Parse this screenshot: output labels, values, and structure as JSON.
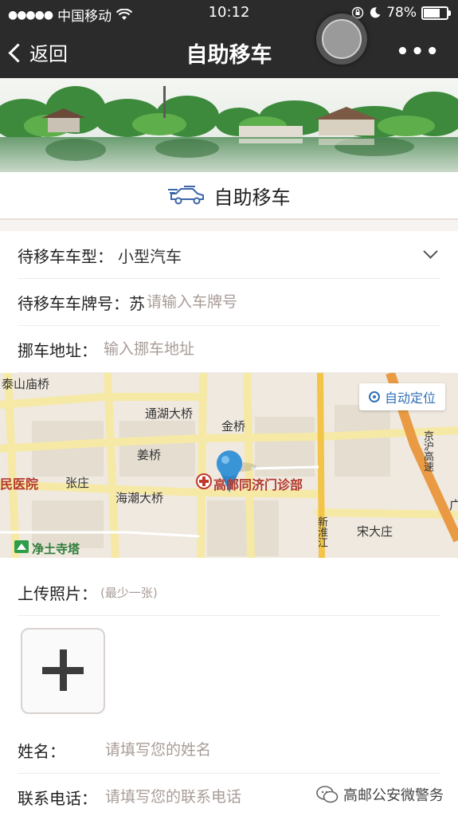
{
  "status_bar": {
    "carrier": "中国移动",
    "time": "10:12",
    "battery": "78%",
    "battery_level": 0.78
  },
  "nav": {
    "back_label": "返回",
    "title": "自助移车",
    "more_label": "•••"
  },
  "header": {
    "title": "自助移车",
    "icon": "car-tow-icon"
  },
  "form": {
    "car_type_label": "待移车车型：",
    "car_type_value": "小型汽车",
    "plate_label": "待移车车牌号：",
    "plate_prefix": "苏",
    "plate_placeholder": "请输入车牌号",
    "address_label": "挪车地址：",
    "address_placeholder": "输入挪车地址",
    "photo_label": "上传照片：",
    "photo_hint": "(最少一张)",
    "name_label": "姓名：",
    "name_placeholder": "请填写您的姓名",
    "phone_label": "联系电话：",
    "phone_placeholder": "请填写您的联系电话"
  },
  "map": {
    "auto_locate": "自动定位",
    "labels": {
      "taishan": "泰山庙桥",
      "tonghu": "通湖大桥",
      "jinqiao": "金桥",
      "jiangqiao": "姜桥",
      "hospital": "民医院",
      "zhangzhuang": "张庄",
      "haichao": "海潮大桥",
      "clinic": "高邮同济门诊部",
      "jingtu": "净土寺塔",
      "songdazhuang": "宋大庄",
      "jinghu": "京沪高速",
      "xinhuai": "新淮江",
      "edge": "广"
    }
  },
  "watermark": "高邮公安微警务",
  "colors": {
    "nav_bg": "#2b2b2b",
    "accent_blue": "#2f6fb6",
    "placeholder": "#a89c97"
  }
}
